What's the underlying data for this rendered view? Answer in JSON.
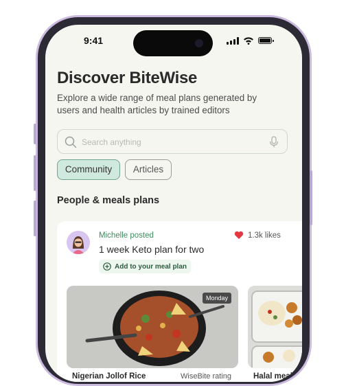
{
  "status": {
    "time": "9:41"
  },
  "header": {
    "title": "Discover BiteWise",
    "subtitle": "Explore a wide range of meal plans generated by users and health articles by trained editors"
  },
  "search": {
    "placeholder": "Search anything"
  },
  "tabs": [
    {
      "label": "Community",
      "active": true
    },
    {
      "label": "Articles",
      "active": false
    }
  ],
  "section": {
    "title": "People & meals plans"
  },
  "post": {
    "author_line": "Michelle posted",
    "plan_title": "1 week Keto plan for two",
    "likes": "1.3k likes",
    "add_label": "Add to your meal plan",
    "meals": [
      {
        "badge": "Monday",
        "name": "Nigerian Jollof Rice",
        "rating_label": "WiseBite rating"
      },
      {
        "name": "Halal meal c"
      }
    ]
  },
  "colors": {
    "accent": "#3d8a5c",
    "chip_active_bg": "#cfe9df",
    "heart": "#e53941"
  }
}
